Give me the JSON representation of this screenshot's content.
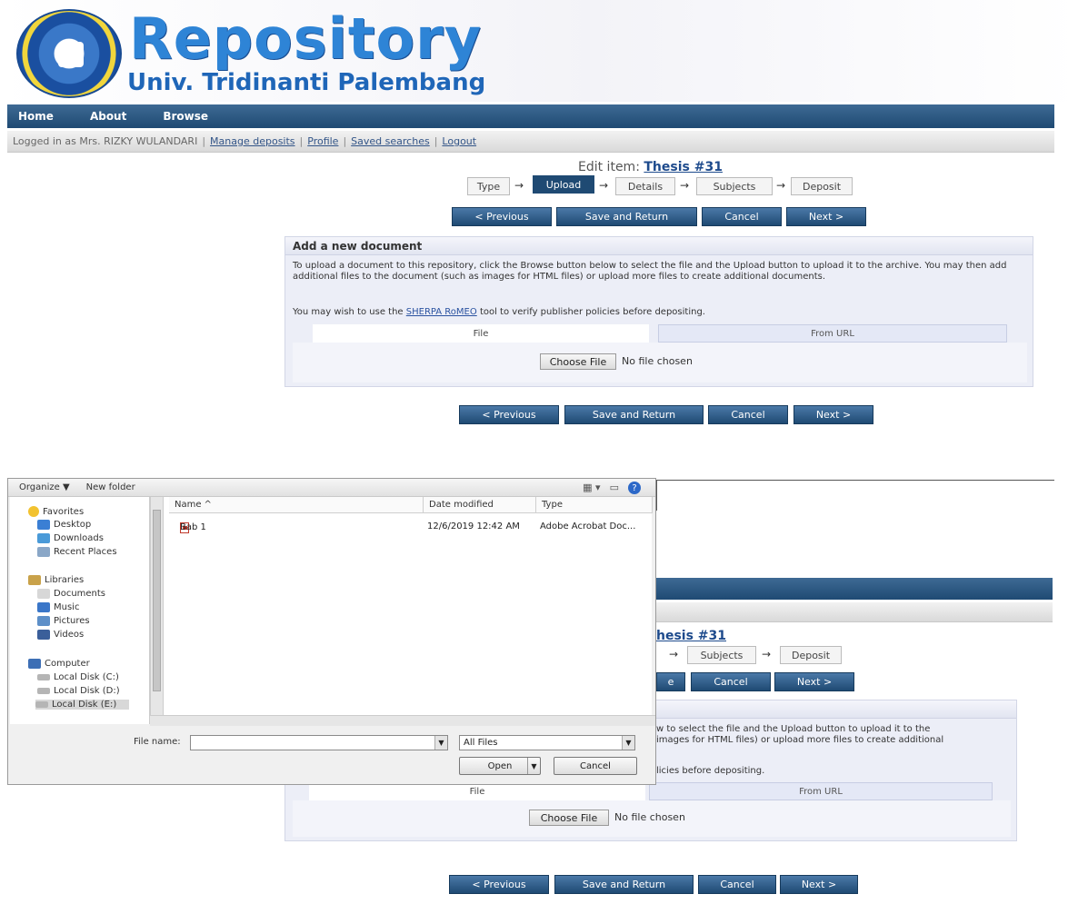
{
  "header": {
    "title": "Repository",
    "subtitle": "Univ. Tridinanti Palembang"
  },
  "nav": {
    "items": [
      "Home",
      "About",
      "Browse"
    ]
  },
  "login_bar": {
    "logged_in_text": "Logged in as Mrs. RIZKY WULANDARI",
    "links": [
      "Manage deposits",
      "Profile",
      "Saved searches",
      "Logout"
    ]
  },
  "edit": {
    "prefix": "Edit item:",
    "item_title": "Thesis #31",
    "steps": [
      "Type",
      "Upload",
      "Details",
      "Subjects",
      "Deposit"
    ],
    "active_step": "Upload"
  },
  "buttons": {
    "previous": "< Previous",
    "save_return": "Save and Return",
    "cancel": "Cancel",
    "next": "Next >"
  },
  "add_document": {
    "heading": "Add a new document",
    "instructions": "To upload a document to this repository, click the Browse button below to select the file and the Upload button to upload it to the archive. You may then add additional files to the document (such as images for HTML files) or upload more files to create additional documents.",
    "sherpa_prefix": "You may wish to use the",
    "sherpa_link": "SHERPA RoMEO",
    "sherpa_suffix": "tool to verify publisher policies before depositing.",
    "tab_file": "File",
    "tab_url": "From URL",
    "choose_file": "Choose File",
    "no_file": "No file chosen"
  },
  "lower_fragments": {
    "thesis": "hesis #31",
    "instr_line1": "w to select the file and the Upload button to upload it to the",
    "instr_line2": "images for HTML files) or upload more files to create additional",
    "sherpa_tail": "licies before depositing.",
    "cancel_partial": "e"
  },
  "dialog": {
    "toolbar": {
      "organize": "Organize ▼",
      "new_folder": "New folder"
    },
    "nav_groups": [
      {
        "label": "Favorites",
        "items": [
          "Desktop",
          "Downloads",
          "Recent Places"
        ]
      },
      {
        "label": "Libraries",
        "items": [
          "Documents",
          "Music",
          "Pictures",
          "Videos"
        ]
      },
      {
        "label": "Computer",
        "items": [
          "Local Disk (C:)",
          "Local Disk (D:)",
          "Local Disk (E:)"
        ]
      }
    ],
    "selected_drive": "Local Disk (E:)",
    "columns": {
      "name": "Name",
      "date": "Date modified",
      "type": "Type"
    },
    "files": [
      {
        "name": "Bab 1",
        "date": "12/6/2019 12:42 AM",
        "type": "Adobe Acrobat Doc..."
      }
    ],
    "file_name_label": "File name:",
    "file_name_value": "",
    "filter_value": "All Files",
    "open": "Open",
    "cancel": "Cancel"
  },
  "colors": {
    "nav_blue": "#1f4a73",
    "title_blue": "#2e84d6",
    "panel_bg": "#eceef7"
  }
}
